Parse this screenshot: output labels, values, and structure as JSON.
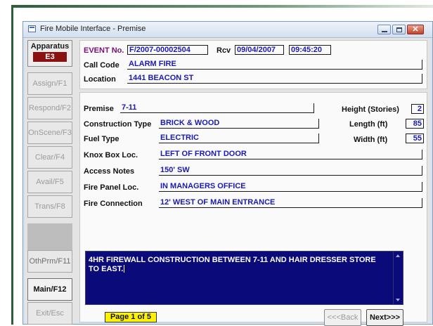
{
  "window": {
    "title": "Fire Mobile Interface - Premise"
  },
  "sidebar": {
    "apparatus_label": "Apparatus",
    "apparatus_id": "E3",
    "buttons": [
      {
        "label": "Assign/F1"
      },
      {
        "label": "Respond/F2"
      },
      {
        "label": "OnScene/F3"
      },
      {
        "label": "Clear/F4"
      },
      {
        "label": "Avail/F5"
      },
      {
        "label": "Trans/F8"
      },
      {
        "label": "OthPrm/F11"
      },
      {
        "label": "Main/F12"
      },
      {
        "label": "Exit/Esc"
      }
    ]
  },
  "event": {
    "event_label": "EVENT No.",
    "event_no": "F/2007-00002504",
    "rcv_label": "Rcv",
    "rcv_date": "09/04/2007",
    "rcv_time": "09:45:20",
    "call_code_label": "Call Code",
    "call_code": "ALARM FIRE",
    "location_label": "Location",
    "location": "1441 BEACON ST"
  },
  "premise": {
    "premise_label": "Premise",
    "premise": "7-11",
    "height_label": "Height (Stories)",
    "height": "2",
    "construction_label": "Construction Type",
    "construction": "BRICK & WOOD",
    "length_label": "Length (ft)",
    "length": "85",
    "fuel_label": "Fuel Type",
    "fuel": "ELECTRIC",
    "width_label": "Width (ft)",
    "width": "55",
    "knox_label": "Knox Box Loc.",
    "knox": "LEFT OF FRONT DOOR",
    "access_label": "Access Notes",
    "access": "150' SW",
    "fire_panel_label": "Fire Panel Loc.",
    "fire_panel": "IN MANAGERS OFFICE",
    "fire_conn_label": "Fire Connection",
    "fire_conn": "12' WEST OF MAIN ENTRANCE",
    "notes": "4HR FIREWALL CONSTRUCTION BETWEEN 7-11 AND HAIR DRESSER STORE TO EAST."
  },
  "footer": {
    "page_indicator": "Page 1 of 5",
    "back_label": "<<<Back",
    "next_label": "Next>>>"
  },
  "colors": {
    "notes_bg": "#0a0a7a",
    "apparatus_bg": "#8b1111",
    "page_indicator_bg": "#fff200",
    "value_text": "#1a1ab0",
    "event_label": "#7a0e7a"
  },
  "icons": [
    "app-window-icon",
    "minimize-icon",
    "maximize-icon",
    "close-icon",
    "scroll-up-arrow-icon",
    "scroll-down-arrow-icon"
  ]
}
